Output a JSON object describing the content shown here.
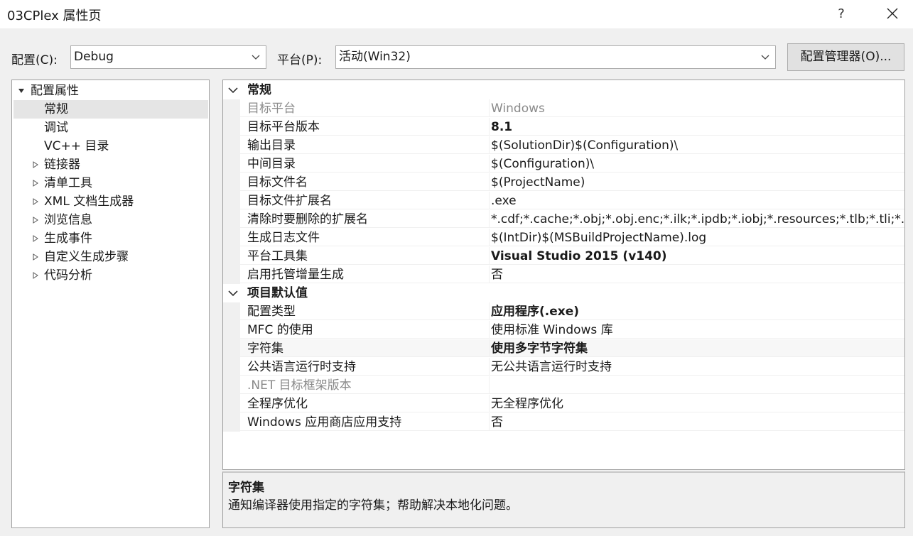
{
  "window": {
    "title": "03CPlex 属性页",
    "help_label": "?"
  },
  "toolbar": {
    "config_label": "配置(C):",
    "config_value": "Debug",
    "platform_label": "平台(P):",
    "platform_value": "活动(Win32)",
    "manager_label": "配置管理器(O)..."
  },
  "tree": {
    "root": "配置属性",
    "items": [
      {
        "label": "常规",
        "selected": true,
        "expandable": false
      },
      {
        "label": "调试",
        "expandable": false
      },
      {
        "label": "VC++ 目录",
        "expandable": false
      },
      {
        "label": "链接器",
        "expandable": true
      },
      {
        "label": "清单工具",
        "expandable": true
      },
      {
        "label": "XML 文档生成器",
        "expandable": true
      },
      {
        "label": "浏览信息",
        "expandable": true
      },
      {
        "label": "生成事件",
        "expandable": true
      },
      {
        "label": "自定义生成步骤",
        "expandable": true
      },
      {
        "label": "代码分析",
        "expandable": true
      }
    ]
  },
  "grid": {
    "categories": [
      {
        "name": "常规",
        "rows": [
          {
            "name": "目标平台",
            "value": "Windows",
            "disabled": true
          },
          {
            "name": "目标平台版本",
            "value": "8.1",
            "bold": true
          },
          {
            "name": "输出目录",
            "value": "$(SolutionDir)$(Configuration)\\"
          },
          {
            "name": "中间目录",
            "value": "$(Configuration)\\"
          },
          {
            "name": "目标文件名",
            "value": "$(ProjectName)"
          },
          {
            "name": "目标文件扩展名",
            "value": ".exe"
          },
          {
            "name": "清除时要删除的扩展名",
            "value": "*.cdf;*.cache;*.obj;*.obj.enc;*.ilk;*.ipdb;*.iobj;*.resources;*.tlb;*.tli;*.tlh;*.tmp;*.rsp;*.pgc;*.pgd"
          },
          {
            "name": "生成日志文件",
            "value": "$(IntDir)$(MSBuildProjectName).log"
          },
          {
            "name": "平台工具集",
            "value": "Visual Studio 2015 (v140)",
            "bold": true
          },
          {
            "name": "启用托管增量生成",
            "value": "否"
          }
        ]
      },
      {
        "name": "项目默认值",
        "rows": [
          {
            "name": "配置类型",
            "value": "应用程序(.exe)",
            "bold": true
          },
          {
            "name": "MFC 的使用",
            "value": "使用标准 Windows 库"
          },
          {
            "name": "字符集",
            "value": "使用多字节字符集",
            "bold": true,
            "highlighted": true
          },
          {
            "name": "公共语言运行时支持",
            "value": "无公共语言运行时支持"
          },
          {
            "name": ".NET 目标框架版本",
            "value": "",
            "disabled": true
          },
          {
            "name": "全程序优化",
            "value": "无全程序优化"
          },
          {
            "name": "Windows 应用商店应用支持",
            "value": "否"
          }
        ]
      }
    ]
  },
  "description": {
    "title": "字符集",
    "text": "通知编译器使用指定的字符集；帮助解决本地化问题。"
  }
}
